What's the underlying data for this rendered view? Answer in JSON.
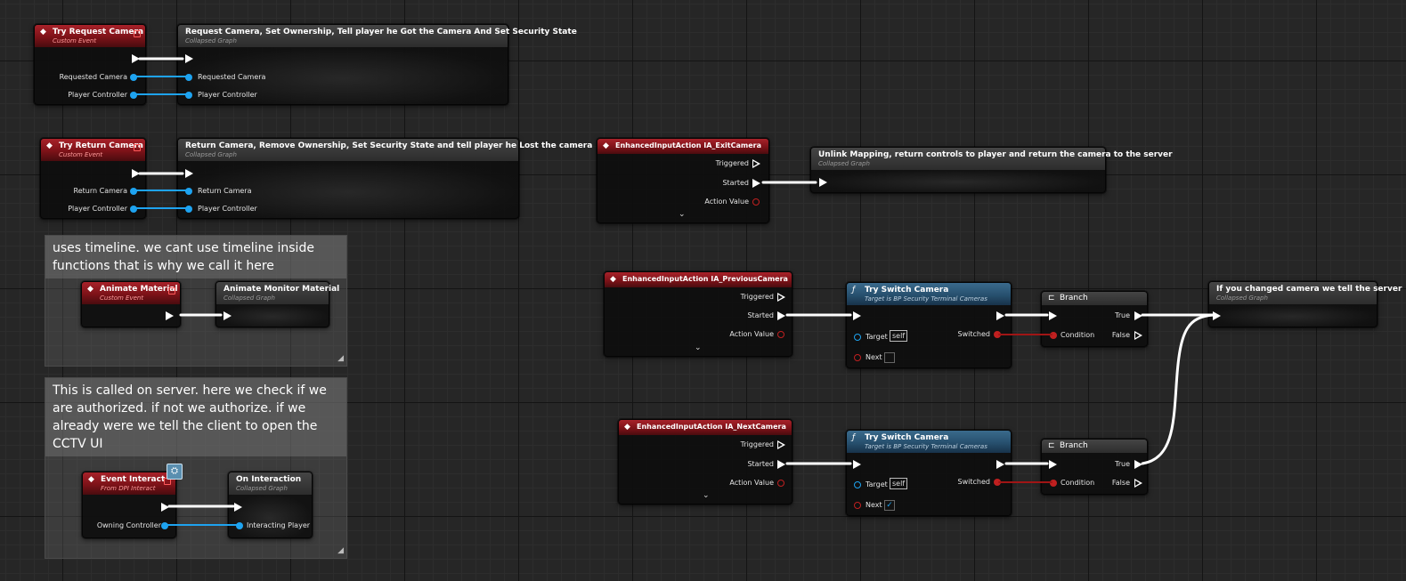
{
  "nodes": {
    "try_request_camera": {
      "title": "Try Request Camera",
      "subtitle": "Custom Event",
      "pins": [
        "Requested Camera",
        "Player Controller"
      ]
    },
    "request_graph": {
      "title": "Request Camera, Set Ownership, Tell player he Got the Camera And Set Security State",
      "subtitle": "Collapsed Graph",
      "pins": [
        "Requested Camera",
        "Player Controller"
      ]
    },
    "try_return_camera": {
      "title": "Try Return Camera",
      "subtitle": "Custom Event",
      "pins": [
        "Return Camera",
        "Player Controller"
      ]
    },
    "return_graph": {
      "title": "Return Camera, Remove Ownership, Set Security State and tell player he Lost the camera",
      "subtitle": "Collapsed Graph",
      "pins": [
        "Return Camera",
        "Player Controller"
      ]
    },
    "ia_exit": {
      "title": "EnhancedInputAction IA_ExitCamera",
      "pins": [
        "Triggered",
        "Started",
        "Action Value"
      ]
    },
    "unlink_graph": {
      "title": "Unlink Mapping, return controls to player and return the camera to the server",
      "subtitle": "Collapsed Graph"
    },
    "animate_material": {
      "title": "Animate Material",
      "subtitle": "Custom Event"
    },
    "animate_graph": {
      "title": "Animate Monitor Material",
      "subtitle": "Collapsed Graph"
    },
    "event_interact": {
      "title": "Event Interact",
      "subtitle": "From DPI Interact",
      "pins": [
        "Owning Controller"
      ]
    },
    "on_interaction": {
      "title": "On Interaction",
      "subtitle": "Collapsed Graph",
      "pins": [
        "Interacting Player"
      ]
    },
    "ia_prev": {
      "title": "EnhancedInputAction IA_PreviousCamera",
      "pins": [
        "Triggered",
        "Started",
        "Action Value"
      ]
    },
    "ia_next": {
      "title": "EnhancedInputAction IA_NextCamera",
      "pins": [
        "Triggered",
        "Started",
        "Action Value"
      ]
    },
    "switch1": {
      "title": "Try Switch Camera",
      "subtitle": "Target is BP Security Terminal Cameras",
      "pins": [
        "Target",
        "Next",
        "Switched"
      ],
      "self": "self"
    },
    "switch2": {
      "title": "Try Switch Camera",
      "subtitle": "Target is BP Security Terminal Cameras",
      "pins": [
        "Target",
        "Next",
        "Switched"
      ],
      "self": "self"
    },
    "branch1": {
      "title": "Branch",
      "pins": [
        "Condition",
        "True",
        "False"
      ]
    },
    "branch2": {
      "title": "Branch",
      "pins": [
        "Condition",
        "True",
        "False"
      ]
    },
    "changed_graph": {
      "title": "If you changed camera we tell the server",
      "subtitle": "Collapsed Graph"
    }
  },
  "comments": {
    "timeline": "uses timeline. we cant use timeline inside functions that is why we call it here",
    "server": "This is called on server. here we check if we are authorized. if not we authorize. if we already were we tell the client to open the CCTV UI"
  },
  "icons": {
    "event": "diamond-event-icon",
    "function": "function-icon",
    "branch": "branch-icon",
    "interface": "interface-badge-icon"
  },
  "colors": {
    "event_header": "#8b1a1f",
    "function_header": "#2f5b7a",
    "exec_wire": "#ffffff",
    "object_pin": "#1ea3f0",
    "bool_pin": "#c02020"
  }
}
